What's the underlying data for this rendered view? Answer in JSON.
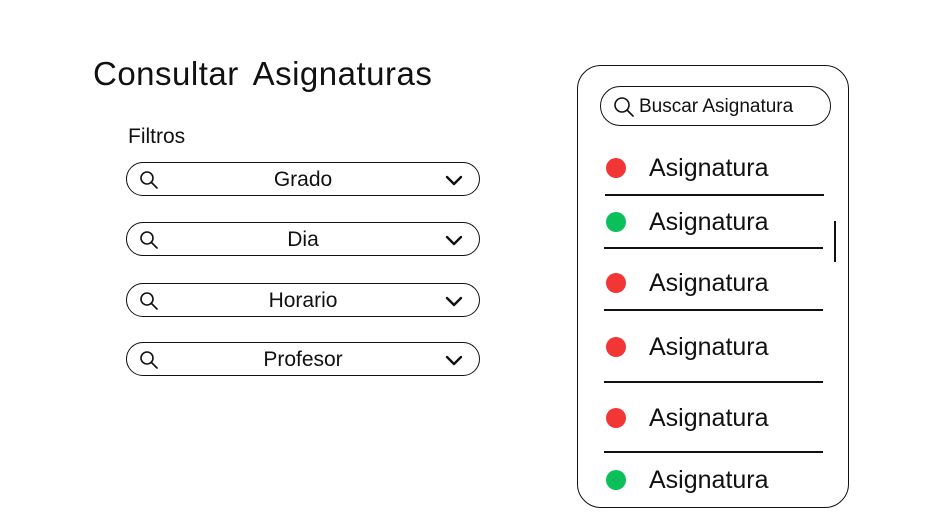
{
  "page": {
    "title": "Consultar Asignaturas"
  },
  "filters": {
    "label": "Filtros",
    "items": [
      {
        "label": "Grado",
        "icon": "search-icon",
        "toggle_icon": "chevron-down-icon"
      },
      {
        "label": "Dia",
        "icon": "search-icon",
        "toggle_icon": "chevron-down-icon"
      },
      {
        "label": "Horario",
        "icon": "search-icon",
        "toggle_icon": "chevron-down-icon"
      },
      {
        "label": "Profesor",
        "icon": "search-icon",
        "toggle_icon": "chevron-down-icon"
      }
    ]
  },
  "subjects_panel": {
    "search": {
      "text": "Buscar Asignatura",
      "icon": "search-icon"
    },
    "items": [
      {
        "name": "Asignatura",
        "status_color": "#f23636"
      },
      {
        "name": "Asignatura",
        "status_color": "#0bbf5b"
      },
      {
        "name": "Asignatura",
        "status_color": "#f23636"
      },
      {
        "name": "Asignatura",
        "status_color": "#f23636"
      },
      {
        "name": "Asignatura",
        "status_color": "#f23636"
      },
      {
        "name": "Asignatura",
        "status_color": "#0bbf5b"
      }
    ]
  }
}
